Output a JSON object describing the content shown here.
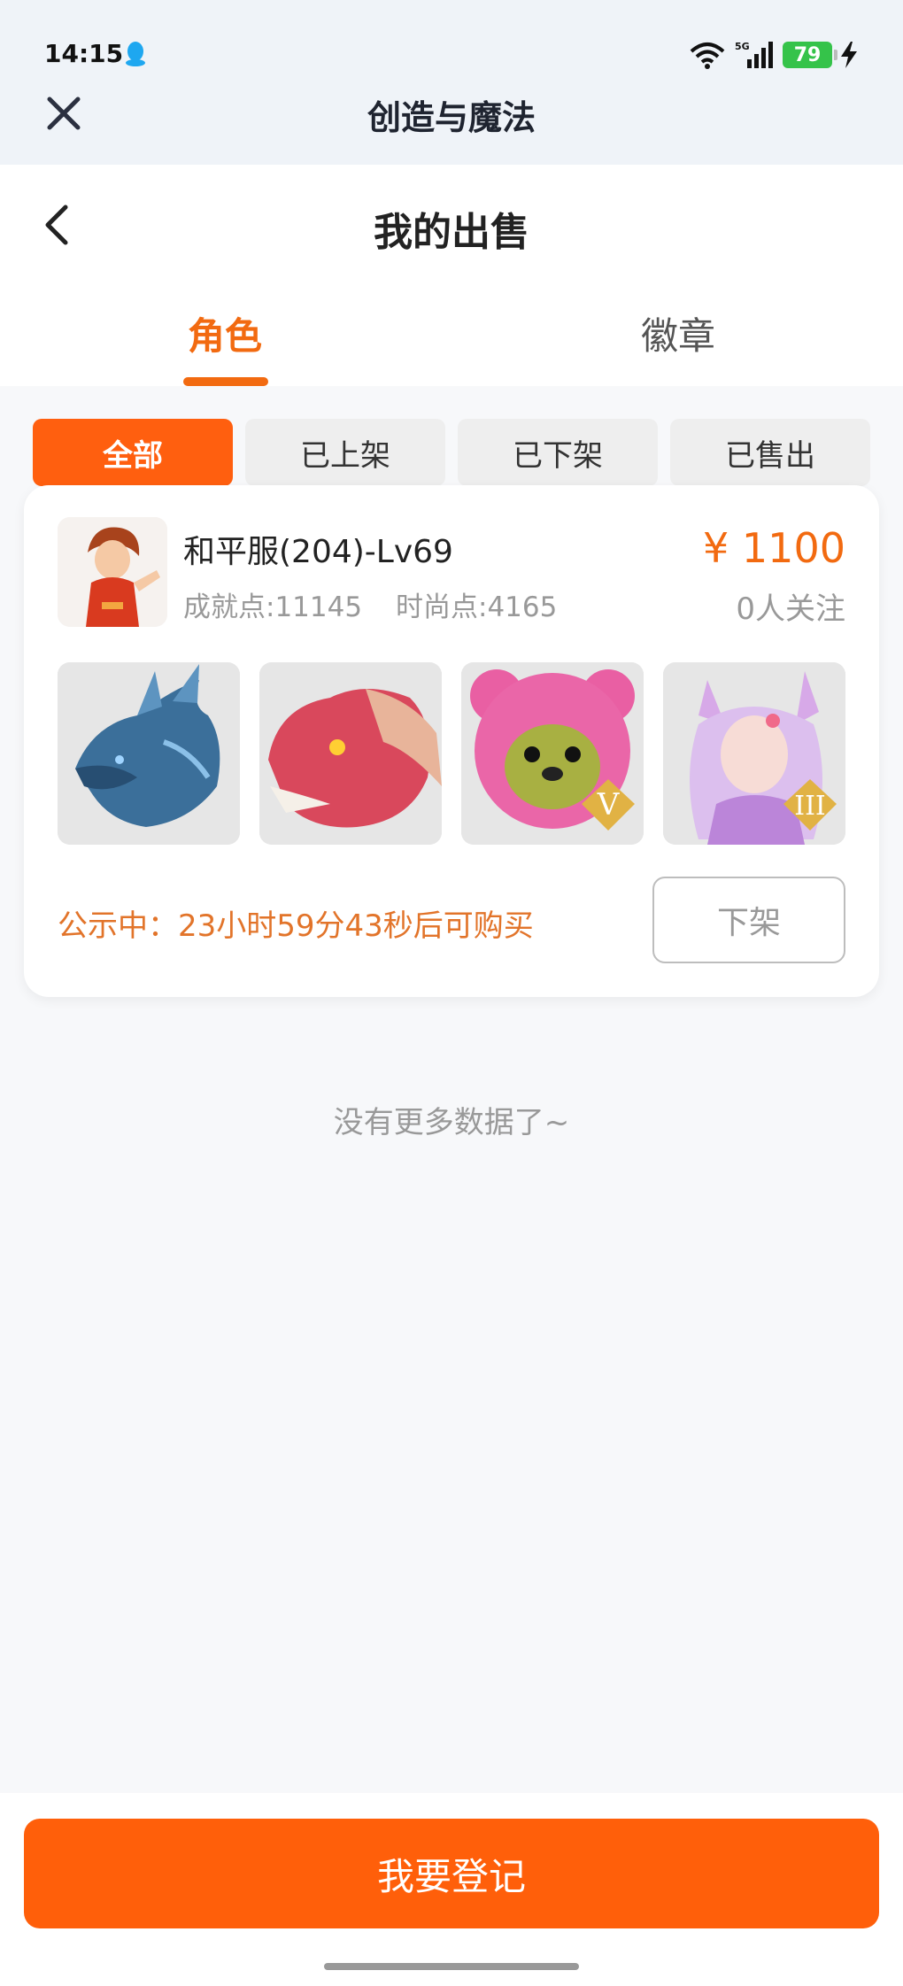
{
  "status_bar": {
    "time": "14:15",
    "battery": "79",
    "network": "5G"
  },
  "title_bar": {
    "title": "创造与魔法"
  },
  "header": {
    "title": "我的出售"
  },
  "tabs": [
    {
      "label": "角色",
      "active": true
    },
    {
      "label": "徽章",
      "active": false
    }
  ],
  "filters": [
    {
      "label": "全部",
      "active": true
    },
    {
      "label": "已上架",
      "active": false
    },
    {
      "label": "已下架",
      "active": false
    },
    {
      "label": "已售出",
      "active": false
    }
  ],
  "listing": {
    "name": "和平服(204)-Lv69",
    "achievement": "成就点:11145",
    "fashion": "时尚点:4165",
    "price": "¥ 1100",
    "followers": "0人关注",
    "items": [
      {
        "icon": "ice-dragon-icon"
      },
      {
        "icon": "red-dragon-icon"
      },
      {
        "icon": "pink-bear-icon",
        "badge": "V"
      },
      {
        "icon": "fox-girl-icon",
        "badge": "III"
      }
    ],
    "notice": "公示中：23小时59分43秒后可购买",
    "delist_label": "下架"
  },
  "footer_note": "没有更多数据了~",
  "register_label": "我要登记",
  "colors": {
    "accent": "#ff5f0f",
    "accent_text": "#f26a10",
    "notice": "#e2742a"
  }
}
